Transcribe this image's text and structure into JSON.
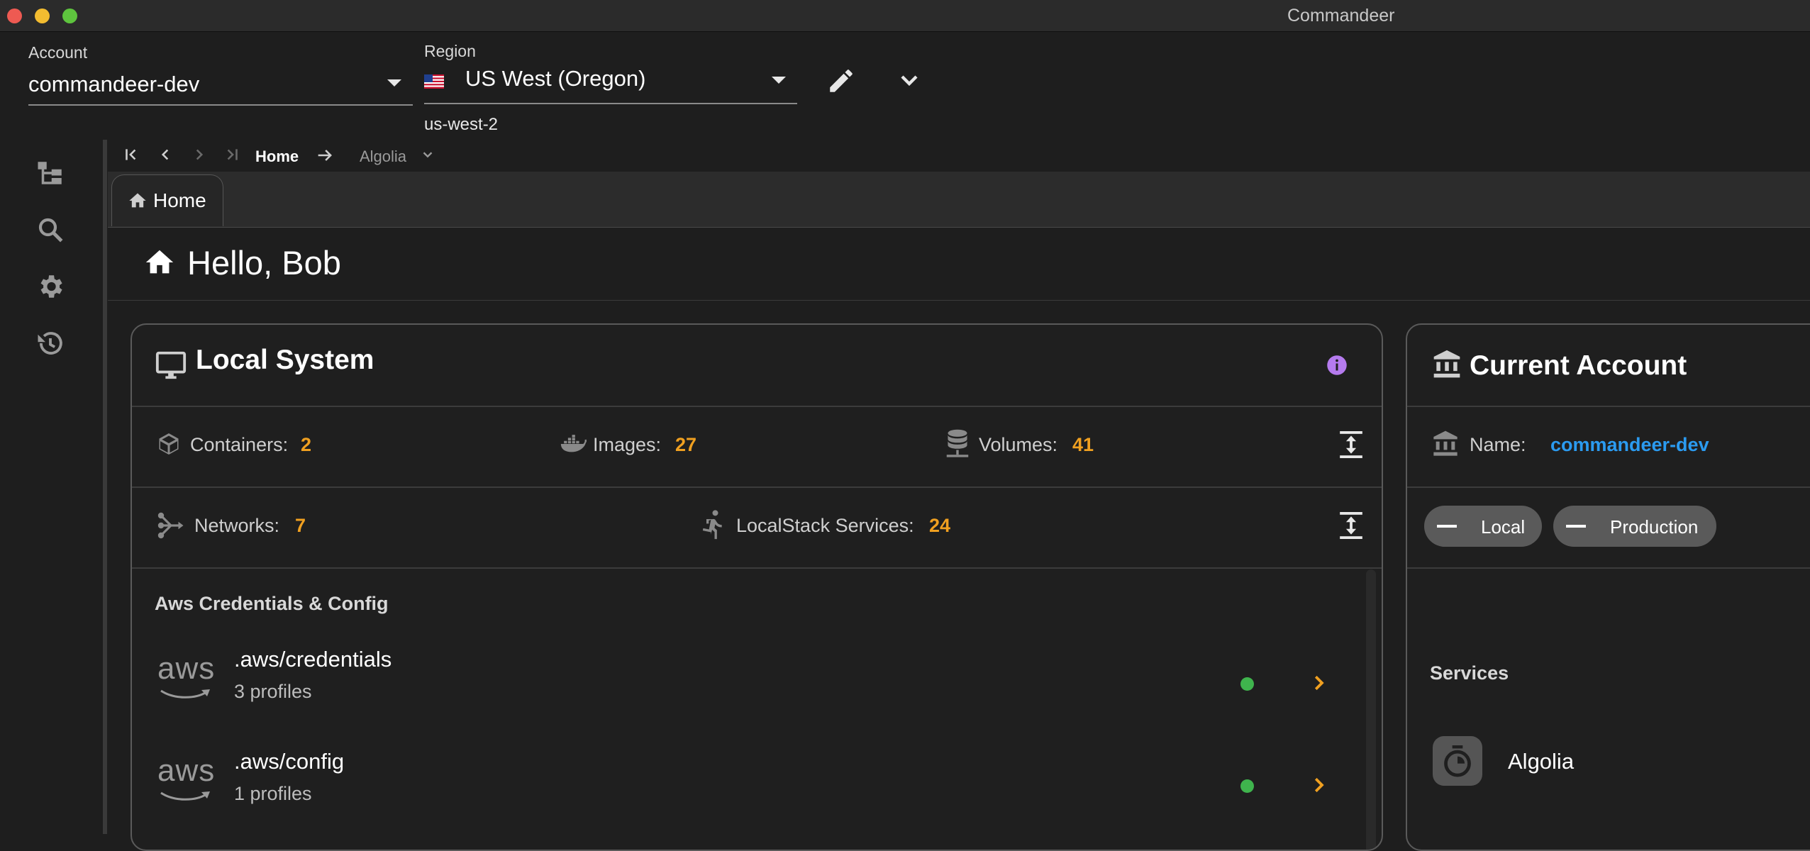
{
  "window": {
    "title": "Commandeer"
  },
  "topbar": {
    "account_label": "Account",
    "account_value": "commandeer-dev",
    "region_label": "Region",
    "region_value": "US West (Oregon)",
    "region_code": "us-west-2"
  },
  "breadcrumbs": {
    "home": "Home",
    "current": "Algolia"
  },
  "tabs": [
    {
      "label": "Home",
      "icon": "home-icon"
    }
  ],
  "greeting": "Hello, Bob",
  "local_system": {
    "title": "Local System",
    "stats_row1": [
      {
        "label": "Containers:",
        "value": "2",
        "icon": "cube-icon"
      },
      {
        "label": "Images:",
        "value": "27",
        "icon": "docker-icon"
      },
      {
        "label": "Volumes:",
        "value": "41",
        "icon": "database-icon"
      }
    ],
    "stats_row2": [
      {
        "label": "Networks:",
        "value": "7",
        "icon": "network-icon"
      },
      {
        "label": "LocalStack Services:",
        "value": "24",
        "icon": "runner-icon"
      }
    ],
    "credentials_section": "Aws Credentials & Config",
    "files": [
      {
        "title": ".aws/credentials",
        "subtitle": "3 profiles",
        "logo": "aws"
      },
      {
        "title": ".aws/config",
        "subtitle": "1 profiles",
        "logo": "aws"
      }
    ]
  },
  "current_account": {
    "title": "Current Account",
    "name_label": "Name:",
    "name_value": "commandeer-dev",
    "chips": [
      "Local",
      "Production"
    ],
    "services_section": "Services",
    "services": [
      {
        "name": "Algolia",
        "icon": "stopwatch-icon"
      }
    ]
  },
  "colors": {
    "accent_value": "#f0a020",
    "link": "#2b9bf0",
    "status_ok": "#3fb44d",
    "info_badge": "#b57bee"
  }
}
